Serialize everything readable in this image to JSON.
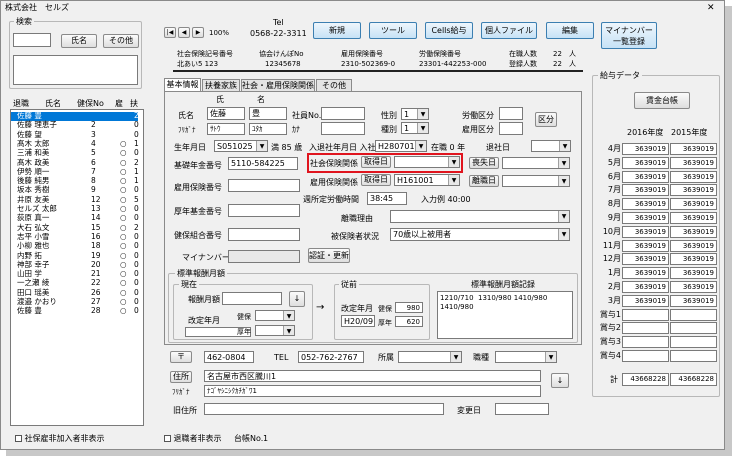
{
  "window": {
    "title": "株式会社　セルズ",
    "close": "✕"
  },
  "search": {
    "title": "検索",
    "value": "",
    "name_btn": "氏名",
    "other_btn": "その他"
  },
  "list": {
    "headers": [
      "退職",
      "氏名",
      "健保No",
      "雇",
      "扶"
    ],
    "rows": [
      {
        "name": "佐藤 豊",
        "no": "",
        "ko": "",
        "fu": "2"
      },
      {
        "name": "佐藤 理恵子",
        "no": "2",
        "ko": "",
        "fu": "0"
      },
      {
        "name": "佐藤 望",
        "no": "3",
        "ko": "",
        "fu": "0"
      },
      {
        "name": "髙木 太郎",
        "no": "4",
        "ko": "○",
        "fu": "1"
      },
      {
        "name": "三浦 和美",
        "no": "5",
        "ko": "○",
        "fu": "0"
      },
      {
        "name": "髙木 政美",
        "no": "6",
        "ko": "○",
        "fu": "2"
      },
      {
        "name": "伊勢 順一",
        "no": "7",
        "ko": "○",
        "fu": "1"
      },
      {
        "name": "後藤 純男",
        "no": "8",
        "ko": "○",
        "fu": "1"
      },
      {
        "name": "坂本 秀樹",
        "no": "9",
        "ko": "○",
        "fu": "0"
      },
      {
        "name": "井原 友美",
        "no": "12",
        "ko": "○",
        "fu": "5"
      },
      {
        "name": "セルズ 太郎",
        "no": "13",
        "ko": "○",
        "fu": "0"
      },
      {
        "name": "荻原 真一",
        "no": "14",
        "ko": "○",
        "fu": "0"
      },
      {
        "name": "大石 弘文",
        "no": "15",
        "ko": "○",
        "fu": "2"
      },
      {
        "name": "志平 小雪",
        "no": "16",
        "ko": "○",
        "fu": "0"
      },
      {
        "name": "小柳 雅也",
        "no": "18",
        "ko": "○",
        "fu": "0"
      },
      {
        "name": "内野 拓",
        "no": "19",
        "ko": "○",
        "fu": "0"
      },
      {
        "name": "神部 幸子",
        "no": "20",
        "ko": "○",
        "fu": "0"
      },
      {
        "name": "山田 学",
        "no": "21",
        "ko": "○",
        "fu": "0"
      },
      {
        "name": "一之瀬 綾",
        "no": "22",
        "ko": "○",
        "fu": "0"
      },
      {
        "name": "田口 瑶美",
        "no": "26",
        "ko": "○",
        "fu": "0"
      },
      {
        "name": "渡邉 かおり",
        "no": "27",
        "ko": "○",
        "fu": "0"
      },
      {
        "name": "佐藤 豊",
        "no": "28",
        "ko": "○",
        "fu": "0"
      }
    ]
  },
  "bottom": {
    "social": "社保雇非加入者非表示",
    "retired": "退職者非表示",
    "ledger": "台帳No.",
    "ledger_val": "1"
  },
  "nav": {
    "first": "|◀",
    "prev": "◀",
    "next": "▶",
    "zoom": "100%"
  },
  "tel": {
    "label": "Tel",
    "value": "0568-22-3311"
  },
  "toolbar": {
    "new": "新規",
    "tool": "ツール",
    "cells": "Cells給与",
    "personal": "個人ファイル",
    "edit": "編集",
    "mynumber1": "マイナンバー",
    "mynumber2": "一覧登録"
  },
  "insurance": {
    "h1": "社会保険記号番号",
    "v1": "北あい5 123",
    "h2": "協会けんぽNo",
    "v2": "12345678",
    "h3": "雇用保険番号",
    "v3": "2310-502369-0",
    "h4": "労働保険番号",
    "v4": "23301-442253-000",
    "l5": "在職人数",
    "n5": "22",
    "u5": "人",
    "l6": "登録人数",
    "n6": "22",
    "u6": "人"
  },
  "tabs": [
    "基本情報",
    "扶養家族",
    "社会・雇用保険関係",
    "その他"
  ],
  "basic": {
    "name_label": "氏名",
    "col_sei": "氏",
    "col_mei": "名",
    "sei": "佐藤",
    "mei": "豊",
    "furi_label": "ﾌﾘｶﾞﾅ",
    "furi_sei": "ｻﾄｳ",
    "furi_mei": "ﾕﾀｶ",
    "shain_label": "社員No.",
    "shain_val": "",
    "sex_label": "性別",
    "sex_val": "1",
    "kana_label": "ｶﾅ",
    "kana_val": "",
    "type_label": "種別",
    "type_val": "1",
    "rodo_label": "労働区分",
    "koyo_label": "雇用区分",
    "kubun_btn": "区分",
    "birth_label": "生年月日",
    "birth_val": "S051025",
    "age": "満 85 歳",
    "entry_label": "入退社年月日 入社",
    "entry_val": "H280701",
    "tenure": "在職 0 年",
    "leave_label": "退社日",
    "pension_label": "基礎年金番号",
    "pension_val": "5110-584225",
    "social_label": "社会保険関係",
    "acq_btn": "取得日",
    "loss_btn": "喪失日",
    "koyo_ins_label": "雇用保険番号",
    "emp_rel_label": "雇用保険関係",
    "emp_acq_val": "H161001",
    "leave_btn": "離職日",
    "kosei_label": "厚年基金番号",
    "weekly_label": "週所定労働時間",
    "weekly_val": "38:45",
    "nyuryoku": "入力例 40:00",
    "reason_label": "離職理由",
    "kenpo_label": "健保組合番号",
    "dependent_label": "被保険者状況",
    "dependent_val": "70歳以上被用者",
    "mynumber_label": "マイナンバー",
    "confirm_btn": "認証・更新"
  },
  "std": {
    "title": "標準報酬月額",
    "current": "現在",
    "kojin_label": "報酬月額",
    "revise_label": "改定年月",
    "kenpo": "健保",
    "kosei": "厚年",
    "prev": "従前",
    "prev_revise": "改定年月",
    "prev_date": "H20/09",
    "prev_kenpo": "980",
    "prev_kosei": "620",
    "record_title": "標準報酬月額記録",
    "record_text": "1210/710  1310/980 1410/980\n1410/980"
  },
  "address": {
    "zip_label": "〒",
    "zip": "462-0804",
    "tel_label": "TEL",
    "tel": "052-762-2767",
    "dept_label": "所属",
    "post_label": "職種",
    "addr_label": "住所",
    "addr": "名古屋市西区騰川1",
    "furi_label": "ﾌﾘｶﾞﾅ",
    "addr_furi": "ﾅｺﾞﾔｼﾆｼｸｶﾁｶﾞﾜ1",
    "old_label": "旧住所",
    "change_label": "変更日"
  },
  "salary": {
    "title": "給与データ",
    "btn": "賃金台帳",
    "y1": "2016年度",
    "y2": "2015年度",
    "rows": [
      {
        "m": "4月",
        "a": "3639019",
        "b": "3639019"
      },
      {
        "m": "5月",
        "a": "3639019",
        "b": "3639019"
      },
      {
        "m": "6月",
        "a": "3639019",
        "b": "3639019"
      },
      {
        "m": "7月",
        "a": "3639019",
        "b": "3639019"
      },
      {
        "m": "8月",
        "a": "3639019",
        "b": "3639019"
      },
      {
        "m": "9月",
        "a": "3639019",
        "b": "3639019"
      },
      {
        "m": "10月",
        "a": "3639019",
        "b": "3639019"
      },
      {
        "m": "11月",
        "a": "3639019",
        "b": "3639019"
      },
      {
        "m": "12月",
        "a": "3639019",
        "b": "3639019"
      },
      {
        "m": "1月",
        "a": "3639019",
        "b": "3639019"
      },
      {
        "m": "2月",
        "a": "3639019",
        "b": "3639019"
      },
      {
        "m": "3月",
        "a": "3639019",
        "b": "3639019"
      },
      {
        "m": "賞与1",
        "a": "",
        "b": ""
      },
      {
        "m": "賞与2",
        "a": "",
        "b": ""
      },
      {
        "m": "賞与3",
        "a": "",
        "b": ""
      },
      {
        "m": "賞与4",
        "a": "",
        "b": ""
      }
    ],
    "total_label": "計",
    "total_a": "43668228",
    "total_b": "43668228"
  },
  "colors": {
    "highlight": "#0078d7",
    "accent_red": "#e0141e",
    "btn_blue": "#c6e2f6"
  }
}
